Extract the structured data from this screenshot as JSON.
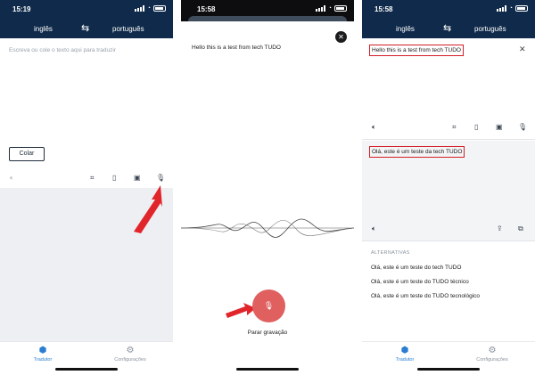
{
  "panel1": {
    "status_time": "15:19",
    "source_lang": "inglês",
    "target_lang": "português",
    "placeholder": "Escreva ou cole o texto aqui para traduzir",
    "paste_label": "Colar",
    "tab_translator": "Tradutor",
    "tab_settings": "Configurações"
  },
  "panel2": {
    "status_time": "15:58",
    "recognized_text": "Hello this is a test from tech TUDO",
    "stop_label": "Parar gravação"
  },
  "panel3": {
    "status_time": "15:58",
    "source_lang": "inglês",
    "target_lang": "português",
    "input_text": "Hello this is a test from tech TUDO",
    "output_text": "Olá, este é um teste da tech TUDO",
    "alternatives_header": "ALTERNATIVAS",
    "alternatives": [
      "Olá, este é um teste do tech TUDO",
      "Olá, este é um teste do TUDO técnico",
      "Olá, este é um teste do TUDO tecnológico"
    ],
    "tab_translator": "Tradutor",
    "tab_settings": "Configurações"
  },
  "colors": {
    "navbar": "#0f2a4a",
    "accent": "#2a7dd1",
    "highlight_box": "#d31f26",
    "arrow": "#e0252b",
    "record_button": "#e06060"
  },
  "icons": [
    "swap-icon",
    "speaker-icon",
    "camera-scan-icon",
    "document-icon",
    "image-icon",
    "microphone-icon",
    "share-icon",
    "copy-icon",
    "close-icon",
    "translator-icon",
    "gear-icon"
  ]
}
